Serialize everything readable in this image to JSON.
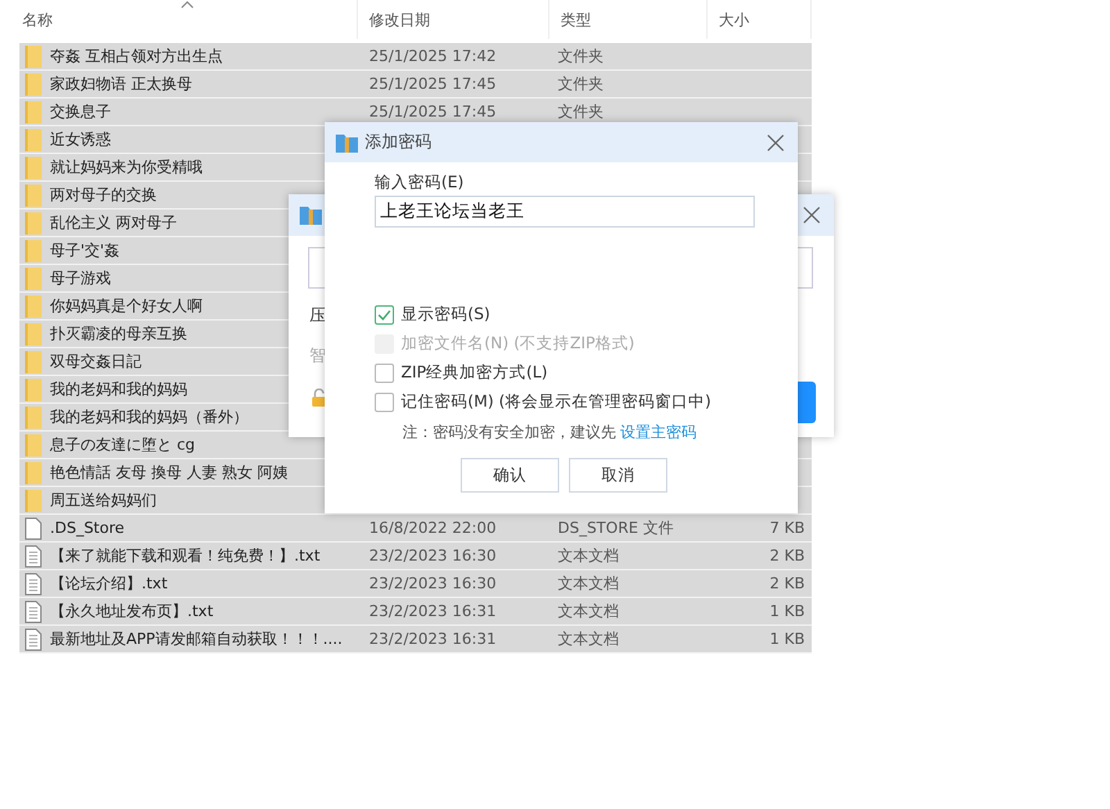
{
  "file_list": {
    "columns": [
      {
        "label": "名称",
        "sorted": true
      },
      {
        "label": "修改日期"
      },
      {
        "label": "类型"
      },
      {
        "label": "大小"
      }
    ],
    "rows": [
      {
        "kind": "folder",
        "name": "夺姦 互相占领对方出生点",
        "modified": "25/1/2025 17:42",
        "type": "文件夹",
        "selected": true
      },
      {
        "kind": "folder",
        "name": "家政妇物语 正太换母",
        "modified": "25/1/2025 17:45",
        "type": "文件夹",
        "selected": true
      },
      {
        "kind": "folder",
        "name": "交换息子",
        "modified": "25/1/2025 17:45",
        "type": "文件夹",
        "selected": true
      },
      {
        "kind": "folder",
        "name": "近女诱惑",
        "selected": true
      },
      {
        "kind": "folder",
        "name": "就让妈妈来为你受精哦",
        "selected": true
      },
      {
        "kind": "folder",
        "name": "两对母子的交换",
        "selected": true
      },
      {
        "kind": "folder",
        "name": "乱伦主义 两对母子",
        "selected": true
      },
      {
        "kind": "folder",
        "name": "母子'交'姦",
        "selected": true
      },
      {
        "kind": "folder",
        "name": "母子游戏",
        "selected": true
      },
      {
        "kind": "folder",
        "name": "你妈妈真是个好女人啊",
        "selected": true
      },
      {
        "kind": "folder",
        "name": "扑灭霸凌的母亲互换",
        "selected": true
      },
      {
        "kind": "folder",
        "name": "双母交姦日記",
        "selected": true
      },
      {
        "kind": "folder",
        "name": "我的老妈和我的妈妈",
        "selected": true
      },
      {
        "kind": "folder",
        "name": "我的老妈和我的妈妈（番外）",
        "selected": true
      },
      {
        "kind": "folder",
        "name": "息子の友達に堕と cg",
        "selected": true
      },
      {
        "kind": "folder",
        "name": "艳色情話 友母 換母 人妻 熟女 阿姨",
        "selected": true
      },
      {
        "kind": "folder",
        "name": "周五送给妈妈们",
        "selected": true
      },
      {
        "kind": "file",
        "name": ".DS_Store",
        "modified": "16/8/2022 22:00",
        "type": "DS_STORE 文件",
        "size": "7 KB",
        "selected": true
      },
      {
        "kind": "text",
        "name": "【来了就能下载和观看！纯免费！】.txt",
        "modified": "23/2/2023 16:30",
        "type": "文本文档",
        "size": "2 KB",
        "selected": true
      },
      {
        "kind": "text",
        "name": "【论坛介绍】.txt",
        "modified": "23/2/2023 16:30",
        "type": "文本文档",
        "size": "2 KB",
        "selected": true
      },
      {
        "kind": "text",
        "name": "【永久地址发布页】.txt",
        "modified": "23/2/2023 16:31",
        "type": "文本文档",
        "size": "1 KB",
        "selected": true
      },
      {
        "kind": "text",
        "name": "最新地址及APP请发邮箱自动获取！！！....",
        "modified": "23/2/2023 16:31",
        "type": "文本文档",
        "size": "1 KB",
        "selected": true
      }
    ]
  },
  "back_dialog": {
    "label": "压",
    "hint": "智"
  },
  "password_dialog": {
    "title": "添加密码",
    "password_label": "输入密码(E)",
    "password_value": "上老王论坛当老王",
    "options": [
      {
        "label": "显示密码(S)",
        "checked": true,
        "disabled": false
      },
      {
        "label": "加密文件名(N) (不支持ZIP格式)",
        "checked": false,
        "disabled": true
      },
      {
        "label": "ZIP经典加密方式(L)",
        "checked": false,
        "disabled": false
      },
      {
        "label": "记住密码(M) (将会显示在管理密码窗口中)",
        "checked": false,
        "disabled": false
      }
    ],
    "note": "注：密码没有安全加密，建议先",
    "note_link": "设置主密码",
    "buttons": [
      "确认",
      "取消"
    ]
  }
}
